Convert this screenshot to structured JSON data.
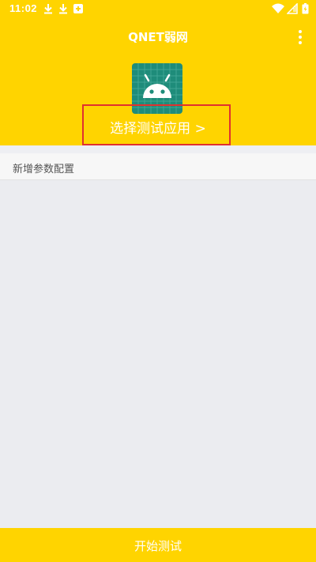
{
  "status_bar": {
    "time": "11:02",
    "left_icons": [
      "download-icon",
      "download-icon",
      "app-notification-icon"
    ],
    "right_icons": [
      "wifi-icon",
      "signal-icon",
      "battery-icon"
    ]
  },
  "app_bar": {
    "title": "QNET弱网",
    "menu_icon": "more-vertical-icon"
  },
  "app_select": {
    "icon": "android-icon",
    "label": "选择测试应用 >"
  },
  "config": {
    "add_label": "新增参数配置"
  },
  "footer": {
    "start_label": "开始测试"
  },
  "colors": {
    "accent": "#FFD400",
    "icon_bg": "#1E8C7A",
    "highlight": "#E0312F",
    "background": "#EBECF0"
  }
}
